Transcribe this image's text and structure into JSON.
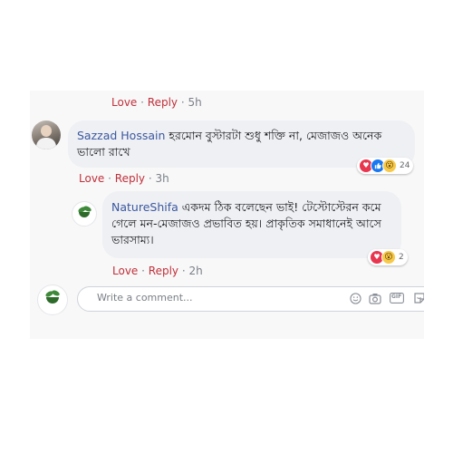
{
  "top_actions": {
    "love": "Love",
    "dot1": "·",
    "reply": "Reply",
    "dot2": "·",
    "time": "5h"
  },
  "comment_1": {
    "author": "Sazzad Hossain",
    "text": "হরমোন বুস্টারটা শুধু শক্তি না, মেজাজও অনেক ভালো রাখে",
    "reaction_icons": [
      "love-icon",
      "like-icon",
      "wow-icon"
    ],
    "reaction_count": "24",
    "actions": {
      "love": "Love",
      "dot1": "·",
      "reply": "Reply",
      "dot2": "·",
      "time": "3h"
    }
  },
  "comment_2": {
    "author": "NatureShifa",
    "text": "একদম ঠিক বলেছেন ভাই! টেস্টোস্টেরন কমে গেলে মন-মেজাজও প্রভাবিত হয়। প্রাকৃতিক সমাধানেই আসে ভারসাম্য।",
    "reaction_icons": [
      "love-icon",
      "wow-icon"
    ],
    "reaction_count": "2",
    "actions": {
      "love": "Love",
      "dot1": "·",
      "reply": "Reply",
      "dot2": "·",
      "time": "2h"
    }
  },
  "composer": {
    "placeholder": "Write a comment...",
    "icons": [
      "emoji-icon",
      "camera-icon",
      "gif-icon",
      "sticker-icon"
    ],
    "gif_label": "GIF"
  },
  "colors": {
    "accent_red": "#c0303a",
    "author_blue": "#3b57a0",
    "bubble_gray": "#eef0f3"
  }
}
